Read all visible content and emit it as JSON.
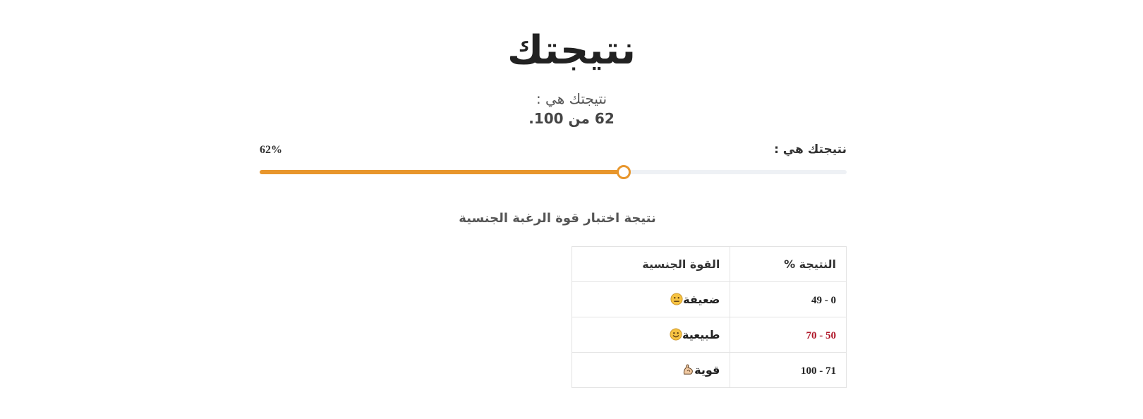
{
  "page": {
    "title": "نتيجتك",
    "subtitle": "نتيجتك هي :",
    "score_text": "62 من 100."
  },
  "progress": {
    "label": "نتيجتك هي :",
    "percent_text": "62%",
    "value": 62,
    "max": 100,
    "colors": {
      "fill": "#e8962c",
      "track": "#eef1f5"
    }
  },
  "section_heading": "نتيجة اختبار قوة الرغبة الجنسية",
  "table": {
    "headers": [
      "النتيجة %",
      "القوة الجنسية"
    ],
    "rows": [
      {
        "range": "0 - 49",
        "strength": "ضعيفة",
        "icon": "neutral-face-icon",
        "highlighted": false
      },
      {
        "range": "50 - 70",
        "strength": "طبيعية",
        "icon": "smiling-face-icon",
        "highlighted": true
      },
      {
        "range": "71 - 100",
        "strength": "قوية",
        "icon": "flexed-biceps-icon",
        "highlighted": false
      }
    ],
    "highlight_color": "#b0182a"
  }
}
